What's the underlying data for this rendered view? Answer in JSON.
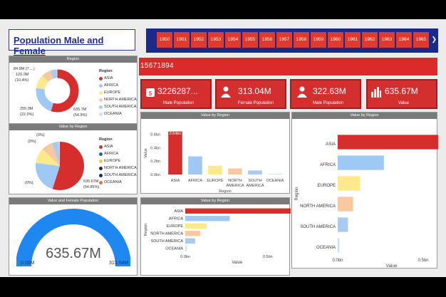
{
  "title": "Population Male and Female",
  "years": [
    "1950",
    "1951",
    "1952",
    "1953",
    "1954",
    "1955",
    "1956",
    "1957",
    "1958",
    "1959",
    "1960",
    "1961",
    "1962",
    "1963",
    "1964",
    "1965"
  ],
  "total_number": "15671894",
  "kpis": [
    {
      "value": "3226287...",
      "label": "Male Population",
      "icon": "person-money-icon"
    },
    {
      "value": "313.04M",
      "label": "Female Population",
      "icon": "person-icon"
    },
    {
      "value": "322.63M",
      "label": "Male Population",
      "icon": "person-icon"
    },
    {
      "value": "635.67M",
      "label": "Value",
      "icon": "bar-chart-icon"
    }
  ],
  "colors": {
    "asia": "#d62d2d",
    "africa": "#9ec9f5",
    "europe": "#fde98c",
    "north_america": "#f8c8a0",
    "south_america": "#a8cbef",
    "oceania": "#cfdff5"
  },
  "donut": {
    "header": "Region",
    "legend_title": "Region",
    "legend": [
      "ASIA",
      "AFRICA",
      "EUROPE",
      "NORTH AMERICA",
      "SOUTH AMERICA",
      "OCEANIA"
    ],
    "label_top": "84.8M (7....)",
    "label_top2": "120.0M",
    "label_top3": "(10.4%)",
    "label_left": "255.0M",
    "label_left2": "(22.0%)",
    "label_right": "635.7M",
    "label_right2": "(54.9%)"
  },
  "pie": {
    "header": "Value by Region",
    "legend_title": "Region",
    "legend": [
      "ASIA",
      "AFRICA",
      "EUROPE",
      "NORTH AMERICA",
      "SOUTH AMERICA",
      "OCEANIA"
    ],
    "label_a": "(0%)",
    "label_b": "(0%)",
    "label_c": "(0%)",
    "label_right": "635.67M",
    "label_right2": "(54.85%)"
  },
  "gauge": {
    "header": "Value and Female Population",
    "value": "635.67M",
    "min": "0.00M",
    "max": "313.04M"
  },
  "chart_data": [
    {
      "type": "bar",
      "title": "Value by Region",
      "orientation": "vertical",
      "categories": [
        "ASIA",
        "AFRICA",
        "EUROPE",
        "NORTH AMERICA",
        "SOUTH AMERICA",
        "OCEANIA"
      ],
      "values": [
        0.64,
        0.27,
        0.13,
        0.09,
        0.06,
        0.01
      ],
      "data_label": "0.64bn",
      "xlabel": "Region",
      "ylabel": "Value",
      "yticks": [
        "0.6bn",
        "0.4bn",
        "0.2bn",
        "0.0bn"
      ],
      "ylim": [
        0,
        0.7
      ]
    },
    {
      "type": "bar",
      "title": "Value by Region",
      "orientation": "horizontal",
      "categories": [
        "ASIA",
        "AFRICA",
        "EUROPE",
        "NORTH AMERICA",
        "SOUTH AMERICA",
        "OCEANIA"
      ],
      "values": [
        0.64,
        0.27,
        0.13,
        0.09,
        0.06,
        0.01
      ],
      "data_label": "0.64bn",
      "xlabel": "Value",
      "ylabel": "Region",
      "xticks": [
        "0.0bn",
        "0.5bn"
      ],
      "xlim": [
        0,
        0.7
      ]
    },
    {
      "type": "bar",
      "title": "Value by Region",
      "orientation": "horizontal",
      "categories": [
        "ASIA",
        "AFRICA",
        "EUROPE",
        "NORTH AMERICA",
        "SOUTH AMERICA",
        "OCEANIA"
      ],
      "values": [
        0.64,
        0.27,
        0.13,
        0.09,
        0.06,
        0.01
      ],
      "data_label": "0.64bn",
      "xlabel": "Value",
      "ylabel": "Region",
      "xticks": [
        "0.0bn",
        "0.5bn"
      ],
      "xlim": [
        0,
        0.7
      ]
    }
  ]
}
